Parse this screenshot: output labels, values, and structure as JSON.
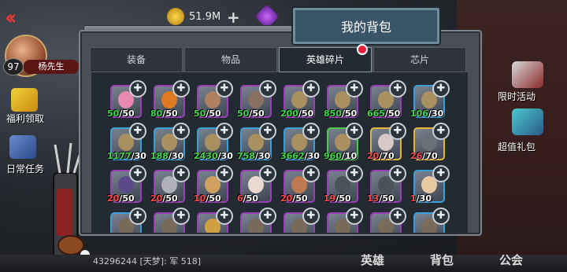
{
  "hud": {
    "player_name": "杨先生",
    "level": "97",
    "currency_amount": "51.9M",
    "plus": "+",
    "left_menu": [
      {
        "label": "福利领取",
        "icon": "gift-box-icon"
      },
      {
        "label": "日常任务",
        "icon": "quest-scroll-icon"
      }
    ],
    "right_menu": [
      {
        "label": "限时活动",
        "icon": "timed-event-icon"
      },
      {
        "label": "超值礼包",
        "icon": "value-pack-icon"
      }
    ],
    "bottom_chat": "43296244 [天梦]: 军 518]",
    "bottom_buttons": [
      "英雄",
      "背包",
      "公会"
    ]
  },
  "window": {
    "title": "我的背包",
    "tabs": [
      {
        "label": "装备",
        "active": false
      },
      {
        "label": "物品",
        "active": false
      },
      {
        "label": "英雄碎片",
        "active": true
      },
      {
        "label": "芯片",
        "active": false
      }
    ]
  },
  "colors": {
    "accent_red": "#e6203a",
    "count_green": "#41d84a",
    "count_red": "#ff4a4a",
    "frame_purple": "#9a3fb8",
    "frame_blue": "#3a9ed8",
    "frame_gold": "#e0b63a",
    "frame_green": "#48c84a"
  },
  "fragments": [
    {
      "have": "50",
      "need": "/50",
      "frame": "purple",
      "color": "green",
      "face": "#e88ab0"
    },
    {
      "have": "80",
      "need": "/50",
      "frame": "purple",
      "color": "green",
      "face": "#e07a20"
    },
    {
      "have": "50",
      "need": "/50",
      "frame": "purple",
      "color": "green",
      "face": "#b08060"
    },
    {
      "have": "50",
      "need": "/50",
      "frame": "purple",
      "color": "green",
      "face": "#8a7060"
    },
    {
      "have": "200",
      "need": "/50",
      "frame": "purple",
      "color": "green",
      "face": "#a89060"
    },
    {
      "have": "850",
      "need": "/50",
      "frame": "purple",
      "color": "green",
      "face": "#a89060"
    },
    {
      "have": "665",
      "need": "/50",
      "frame": "purple",
      "color": "green",
      "face": "#a89060"
    },
    {
      "have": "106",
      "need": "/30",
      "frame": "blue",
      "color": "green",
      "face": "#a89060"
    },
    {
      "have": "1177",
      "need": "/30",
      "frame": "blue",
      "color": "green",
      "face": "#a89060"
    },
    {
      "have": "188",
      "need": "/30",
      "frame": "blue",
      "color": "green",
      "face": "#a89060"
    },
    {
      "have": "2430",
      "need": "/30",
      "frame": "blue",
      "color": "green",
      "face": "#a89060"
    },
    {
      "have": "758",
      "need": "/30",
      "frame": "blue",
      "color": "green",
      "face": "#a89060"
    },
    {
      "have": "3662",
      "need": "/30",
      "frame": "blue",
      "color": "green",
      "face": "#a89060"
    },
    {
      "have": "960",
      "need": "/10",
      "frame": "green",
      "color": "green",
      "face": "#a89060"
    },
    {
      "have": "20",
      "need": "/70",
      "frame": "gold",
      "color": "red",
      "face": "#d8c8c8"
    },
    {
      "have": "26",
      "need": "/70",
      "frame": "gold",
      "color": "red",
      "face": "#6a707a"
    },
    {
      "have": "20",
      "need": "/50",
      "frame": "purple",
      "color": "red",
      "face": "#5a4a8a"
    },
    {
      "have": "20",
      "need": "/50",
      "frame": "purple",
      "color": "red",
      "face": "#b0b0b8"
    },
    {
      "have": "10",
      "need": "/50",
      "frame": "purple",
      "color": "red",
      "face": "#d0a060"
    },
    {
      "have": "6",
      "need": "/50",
      "frame": "purple",
      "color": "red",
      "face": "#e8d8d0"
    },
    {
      "have": "20",
      "need": "/50",
      "frame": "purple",
      "color": "red",
      "face": "#c07850"
    },
    {
      "have": "19",
      "need": "/50",
      "frame": "purple",
      "color": "red",
      "face": "#4a525a"
    },
    {
      "have": "13",
      "need": "/50",
      "frame": "purple",
      "color": "red",
      "face": "#4a525a"
    },
    {
      "have": "1",
      "need": "/30",
      "frame": "blue",
      "color": "red",
      "face": "#e8c8a0"
    },
    {
      "have": "",
      "need": "",
      "frame": "blue",
      "color": "green",
      "face": "#7a6a5a"
    },
    {
      "have": "",
      "need": "",
      "frame": "purple",
      "color": "green",
      "face": "#7a6a5a"
    },
    {
      "have": "",
      "need": "",
      "frame": "purple",
      "color": "green",
      "face": "#d0a040"
    },
    {
      "have": "",
      "need": "",
      "frame": "purple",
      "color": "green",
      "face": "#7a6a5a"
    },
    {
      "have": "",
      "need": "",
      "frame": "purple",
      "color": "green",
      "face": "#7a6a5a"
    },
    {
      "have": "",
      "need": "",
      "frame": "purple",
      "color": "green",
      "face": "#7a6a5a"
    },
    {
      "have": "",
      "need": "",
      "frame": "purple",
      "color": "green",
      "face": "#7a6a5a"
    },
    {
      "have": "",
      "need": "",
      "frame": "blue",
      "color": "green",
      "face": "#7a6a5a"
    }
  ]
}
